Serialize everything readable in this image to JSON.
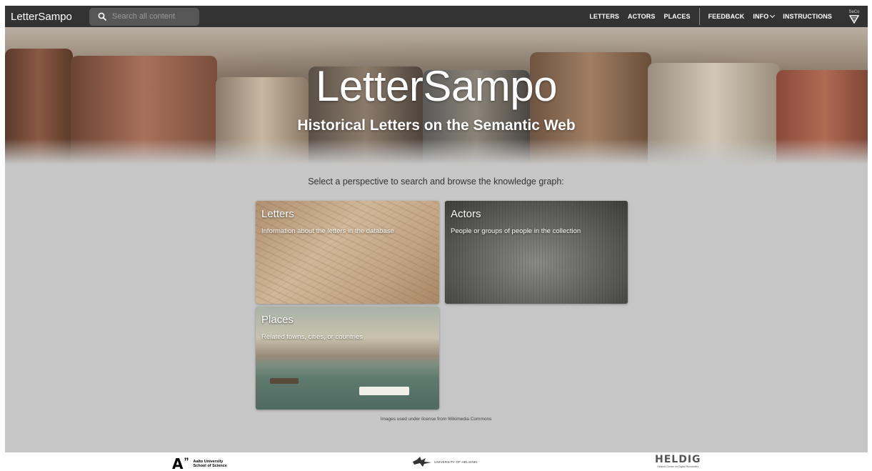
{
  "appbar": {
    "brand": "LetterSampo",
    "search_placeholder": "Search all content",
    "nav": {
      "letters": "LETTERS",
      "actors": "ACTORS",
      "places": "PLACES",
      "feedback": "FEEDBACK",
      "info": "INFO",
      "instructions": "INSTRUCTIONS"
    },
    "seco_logo_text": "SeCo"
  },
  "hero": {
    "title": "LetterSampo",
    "subtitle": "Historical Letters on the Semantic Web"
  },
  "main": {
    "select_text": "Select a perspective to search and browse the knowledge graph:",
    "cards": [
      {
        "title": "Letters",
        "description": "Information about the letters in the database"
      },
      {
        "title": "Actors",
        "description": "People or groups of people in the collection"
      },
      {
        "title": "Places",
        "description": "Related towns, cities, or countries"
      }
    ],
    "license_text": "Images used under license from Wikimedia Commons"
  },
  "footer": {
    "aalto": {
      "mark": "A",
      "quote": "”",
      "line1": "Aalto University",
      "line2": "School of Science"
    },
    "helsinki": "UNIVERSITY OF HELSINKI",
    "heldig": {
      "name": "HELDIG",
      "sub": "Helsinki Centre for Digital Humanities"
    }
  },
  "colors": {
    "appbar": "#333333",
    "search_bg": "#575757",
    "page_bg": "#c6c6c6",
    "footer_bg": "#ffffff"
  },
  "icons": {
    "search": "search-icon",
    "info_dropdown": "chevron-down-icon",
    "seco": "seco-logo-icon"
  }
}
